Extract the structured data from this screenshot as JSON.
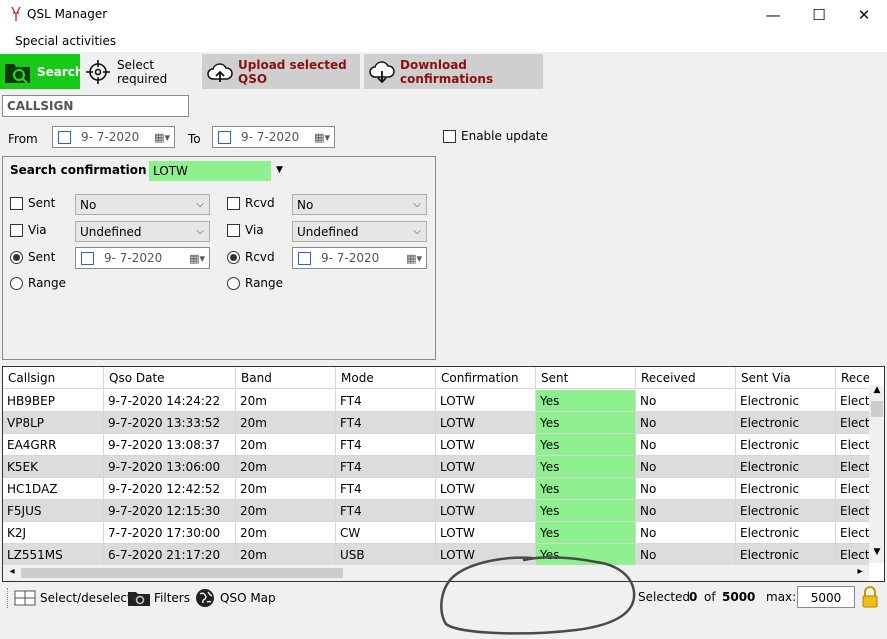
{
  "window": {
    "title": "QSL Manager",
    "minimize": "—",
    "maximize": "☐",
    "close": "✕"
  },
  "menu": {
    "items": [
      "Special activities"
    ]
  },
  "toolbar": {
    "search": "Search",
    "select_required": "Select required",
    "upload": "Upload selected QSO",
    "download": "Download confirmations"
  },
  "callsign": {
    "value": "CALLSIGN"
  },
  "dates": {
    "from_label": "From",
    "from_value": "9-  7-2020",
    "to_label": "To",
    "to_value": "9-  7-2020"
  },
  "enable_update": {
    "label": "Enable update"
  },
  "search_confirmation": {
    "label": "Search confirmation",
    "value": "LOTW",
    "sent_label": "Sent",
    "sent_value": "No",
    "rcvd_label": "Rcvd",
    "rcvd_value": "No",
    "via_label": "Via",
    "via_sent_value": "Undefined",
    "via_rcvd_value": "Undefined",
    "sent_date_label": "Sent",
    "sent_date_value": "9-  7-2020",
    "rcvd_date_label": "Rcvd",
    "rcvd_date_value": "9-  7-2020",
    "range_label": "Range"
  },
  "grid": {
    "columns": [
      "Callsign",
      "Qso Date",
      "Band",
      "Mode",
      "Confirmation",
      "Sent",
      "Received",
      "Sent Via",
      "Rece"
    ],
    "rows": [
      [
        "HB9BEP",
        "9-7-2020 14:24:22",
        "20m",
        "FT4",
        "LOTW",
        "Yes",
        "No",
        "Electronic",
        "Electr"
      ],
      [
        "VP8LP",
        "9-7-2020 13:33:52",
        "20m",
        "FT4",
        "LOTW",
        "Yes",
        "No",
        "Electronic",
        "Electr"
      ],
      [
        "EA4GRR",
        "9-7-2020 13:08:37",
        "20m",
        "FT4",
        "LOTW",
        "Yes",
        "No",
        "Electronic",
        "Electr"
      ],
      [
        "K5EK",
        "9-7-2020 13:06:00",
        "20m",
        "FT4",
        "LOTW",
        "Yes",
        "No",
        "Electronic",
        "Electr"
      ],
      [
        "HC1DAZ",
        "9-7-2020 12:42:52",
        "20m",
        "FT4",
        "LOTW",
        "Yes",
        "No",
        "Electronic",
        "Electr"
      ],
      [
        "F5JUS",
        "9-7-2020 12:15:30",
        "20m",
        "FT4",
        "LOTW",
        "Yes",
        "No",
        "Electronic",
        "Electr"
      ],
      [
        "K2J",
        "7-7-2020 17:30:00",
        "20m",
        "CW",
        "LOTW",
        "Yes",
        "No",
        "Electronic",
        "Electr"
      ],
      [
        "LZ551MS",
        "6-7-2020 21:17:20",
        "20m",
        "USB",
        "LOTW",
        "Yes",
        "No",
        "Electronic",
        "Electr"
      ]
    ]
  },
  "status": {
    "select_deselect": "Select/deselect",
    "filters": "Filters",
    "qso_map": "QSO Map",
    "selected_label": "Selected",
    "selected_count": "0",
    "of_label": "of",
    "total": "5000",
    "max_label": "max:",
    "max_value": "5000"
  },
  "colors": {
    "search_button": "#18c918",
    "sent_yes_cell": "#8ff08f",
    "lotw_field": "#8ff08f",
    "toolbar_button_text": "#8b1010",
    "row_alt": "#dcdcdc"
  }
}
